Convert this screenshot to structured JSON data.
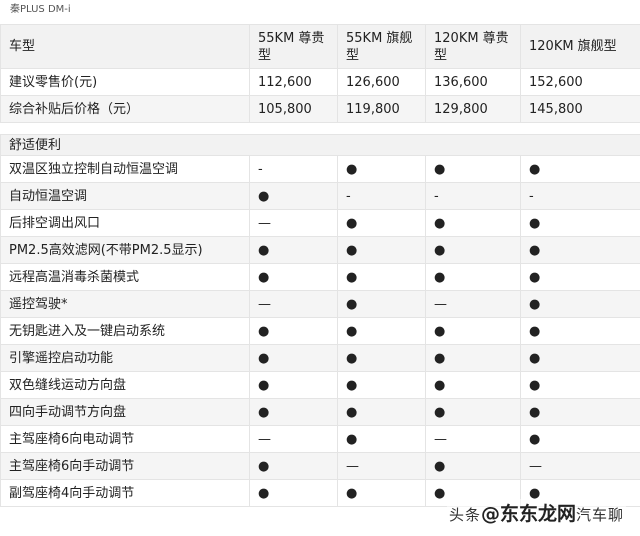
{
  "page_header": "秦PLUS DM-i",
  "table": {
    "header_label": "车型",
    "models": [
      "55KM 尊贵型",
      "55KM 旗舰型",
      "120KM 尊贵型",
      "120KM 旗舰型"
    ],
    "price_rows": [
      {
        "label": "建议零售价(元)",
        "values": [
          "112,600",
          "126,600",
          "136,600",
          "152,600"
        ]
      },
      {
        "label": "综合补贴后价格（元）",
        "values": [
          "105,800",
          "119,800",
          "129,800",
          "145,800"
        ]
      }
    ],
    "section_title": "舒适便利",
    "feature_rows": [
      {
        "label": "双温区独立控制自动恒温空调",
        "values": [
          "-",
          "●",
          "●",
          "●"
        ]
      },
      {
        "label": "自动恒温空调",
        "values": [
          "●",
          "-",
          "-",
          "-"
        ]
      },
      {
        "label": "后排空调出风口",
        "values": [
          "—",
          "●",
          "●",
          "●"
        ]
      },
      {
        "label": "PM2.5高效滤网(不带PM2.5显示)",
        "values": [
          "●",
          "●",
          "●",
          "●"
        ]
      },
      {
        "label": "远程高温消毒杀菌模式",
        "values": [
          "●",
          "●",
          "●",
          "●"
        ]
      },
      {
        "label": "遥控驾驶*",
        "values": [
          "—",
          "●",
          "—",
          "●"
        ]
      },
      {
        "label": "无钥匙进入及一键启动系统",
        "values": [
          "●",
          "●",
          "●",
          "●"
        ]
      },
      {
        "label": "引擎遥控启动功能",
        "values": [
          "●",
          "●",
          "●",
          "●"
        ]
      },
      {
        "label": "双色缝线运动方向盘",
        "values": [
          "●",
          "●",
          "●",
          "●"
        ]
      },
      {
        "label": "四向手动调节方向盘",
        "values": [
          "●",
          "●",
          "●",
          "●"
        ]
      },
      {
        "label": "主驾座椅6向电动调节",
        "values": [
          "—",
          "●",
          "—",
          "●"
        ]
      },
      {
        "label": "主驾座椅6向手动调节",
        "values": [
          "●",
          "—",
          "●",
          "—"
        ]
      },
      {
        "label": "副驾座椅4向手动调节",
        "values": [
          "●",
          "●",
          "●",
          "●"
        ]
      }
    ]
  },
  "watermark": {
    "prefix": "头条",
    "brand": "@东东龙网",
    "suffix": "汽车聊"
  }
}
